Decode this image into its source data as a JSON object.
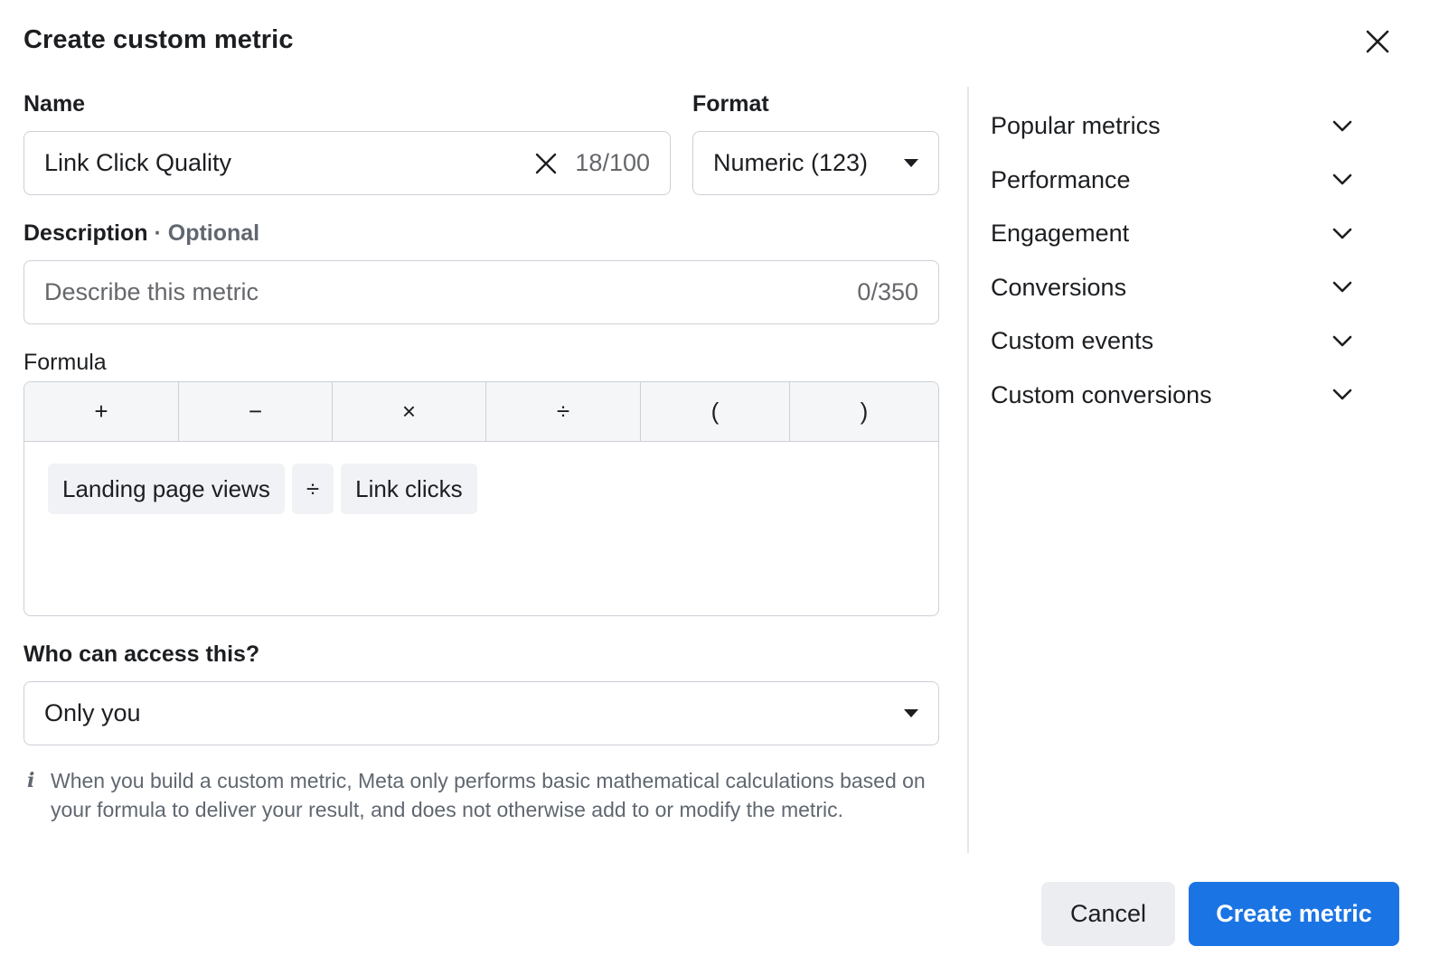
{
  "dialog": {
    "title": "Create custom metric"
  },
  "name_field": {
    "label": "Name",
    "value": "Link Click Quality",
    "counter": "18/100"
  },
  "format_field": {
    "label": "Format",
    "value": "Numeric (123)"
  },
  "description_field": {
    "label": "Description",
    "optional": " · Optional",
    "placeholder": "Describe this metric",
    "counter": "0/350"
  },
  "formula": {
    "label": "Formula",
    "operators": [
      "+",
      "−",
      "×",
      "÷",
      "(",
      ")"
    ],
    "tokens": [
      "Landing page views",
      "÷",
      "Link clicks"
    ]
  },
  "access_field": {
    "label": "Who can access this?",
    "value": "Only you"
  },
  "info_text": "When you build a custom metric, Meta only performs basic mathematical calculations based on your formula to deliver your result, and does not otherwise add to or modify the metric.",
  "categories": [
    "Popular metrics",
    "Performance",
    "Engagement",
    "Conversions",
    "Custom events",
    "Custom conversions"
  ],
  "footer": {
    "cancel_label": "Cancel",
    "create_label": "Create metric"
  },
  "colors": {
    "primary": "#1b74e4",
    "border": "#ccd0d5",
    "muted_text": "#606770"
  },
  "icons": {
    "close": "close-icon",
    "clear": "clear-icon",
    "dropdown": "caret-down-icon",
    "expand": "chevron-down-icon",
    "info": "info-icon"
  }
}
